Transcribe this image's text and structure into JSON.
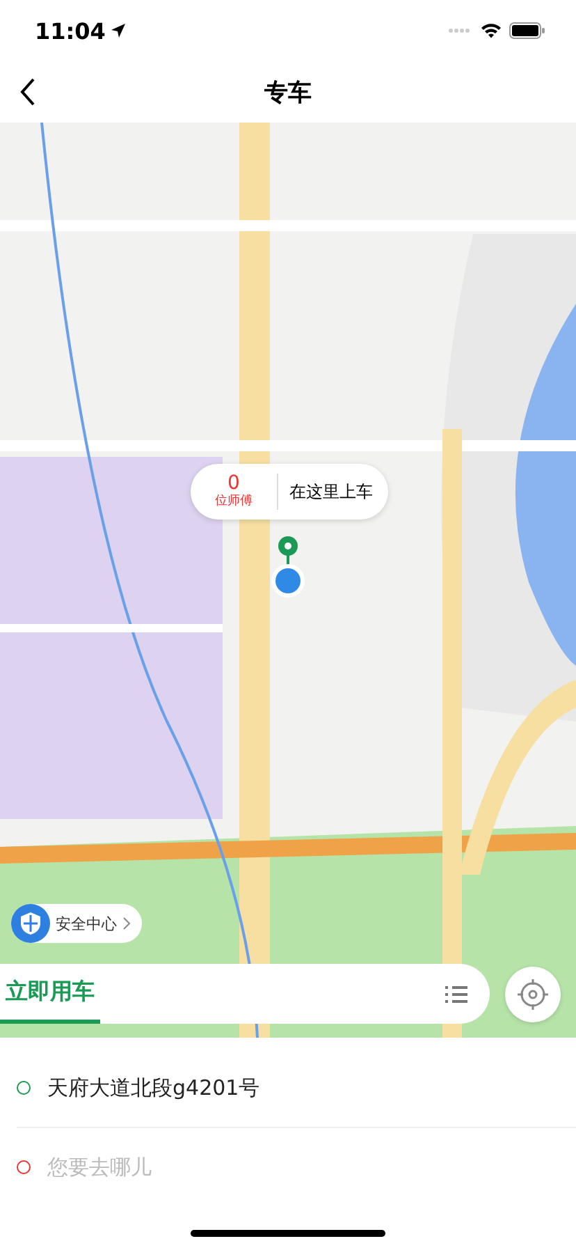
{
  "status_bar": {
    "time": "11:04"
  },
  "nav": {
    "title": "专车"
  },
  "map": {
    "pickup_bubble": {
      "count": "0",
      "count_label": "位师傅",
      "action": "在这里上车"
    },
    "safety_button": {
      "label": "安全中心"
    }
  },
  "tabs": [
    {
      "label": "立即用车",
      "selected": true
    }
  ],
  "route": [
    {
      "kind": "origin",
      "value": "天府大道北段g4201号"
    },
    {
      "kind": "destination",
      "placeholder": "您要去哪儿"
    }
  ]
}
